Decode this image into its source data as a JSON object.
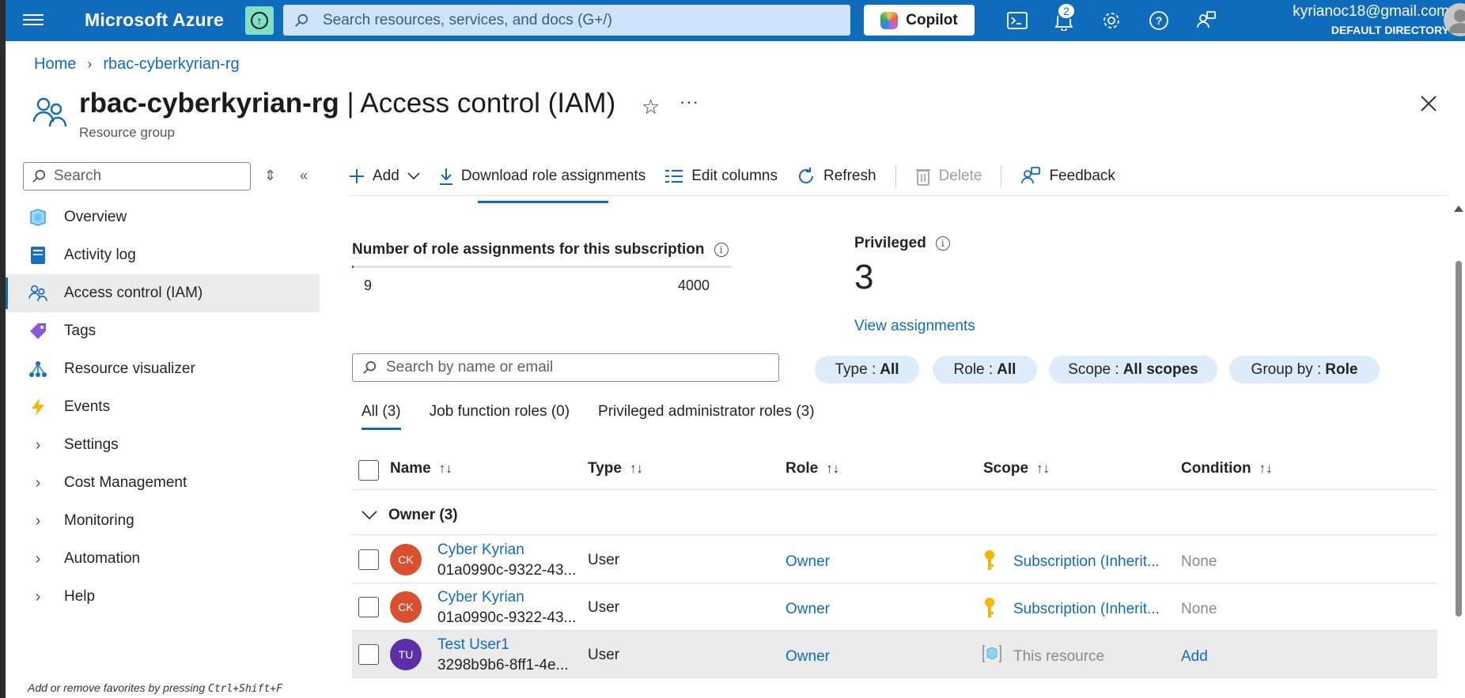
{
  "topbar": {
    "brand": "Microsoft Azure",
    "search_placeholder": "Search resources, services, and docs (G+/)",
    "copilot_label": "Copilot",
    "notification_count": "2",
    "account_email": "kyrianoc18@gmail.com",
    "account_directory": "DEFAULT DIRECTORY"
  },
  "breadcrumb": {
    "home": "Home",
    "resource": "rbac-cyberkyrian-rg"
  },
  "header": {
    "title_resource": "rbac-cyberkyrian-rg",
    "title_sep": " | ",
    "title_page": "Access control (IAM)",
    "subtitle": "Resource group"
  },
  "nav": {
    "search_placeholder": "Search",
    "items": [
      {
        "label": "Overview",
        "icon": "overview-icon"
      },
      {
        "label": "Activity log",
        "icon": "activity-log-icon"
      },
      {
        "label": "Access control (IAM)",
        "icon": "people-icon",
        "selected": true
      },
      {
        "label": "Tags",
        "icon": "tag-icon"
      },
      {
        "label": "Resource visualizer",
        "icon": "visualizer-icon"
      },
      {
        "label": "Events",
        "icon": "lightning-icon"
      },
      {
        "label": "Settings",
        "group": true
      },
      {
        "label": "Cost Management",
        "group": true
      },
      {
        "label": "Monitoring",
        "group": true
      },
      {
        "label": "Automation",
        "group": true
      },
      {
        "label": "Help",
        "group": true
      }
    ],
    "favorites_hint": "Add or remove favorites by pressing ",
    "favorites_keys": "Ctrl+Shift+F"
  },
  "toolbar": {
    "add": "Add",
    "download": "Download role assignments",
    "edit_columns": "Edit columns",
    "refresh": "Refresh",
    "delete": "Delete",
    "feedback": "Feedback"
  },
  "stats": {
    "assignments_label": "Number of role assignments for this subscription",
    "assignments_current": "9",
    "assignments_max": "4000",
    "assignments_fraction": 0.00225,
    "privileged_label": "Privileged",
    "privileged_count": "3",
    "view_assignments": "View assignments"
  },
  "filters": {
    "search_placeholder": "Search by name or email",
    "pills": [
      {
        "key": "Type : ",
        "value": "All"
      },
      {
        "key": "Role : ",
        "value": "All"
      },
      {
        "key": "Scope : ",
        "value": "All scopes"
      },
      {
        "key": "Group by : ",
        "value": "Role"
      }
    ]
  },
  "tabs": [
    {
      "label": "All (3)",
      "selected": true
    },
    {
      "label": "Job function roles (0)"
    },
    {
      "label": "Privileged administrator roles (3)"
    }
  ],
  "table": {
    "columns": [
      "Name",
      "Type",
      "Role",
      "Scope",
      "Condition"
    ],
    "group_label": "Owner (3)",
    "rows": [
      {
        "initials": "CK",
        "avatar_color": "#d9502e",
        "name": "Cyber Kyrian",
        "id": "01a0990c-9322-43...",
        "type": "User",
        "role": "Owner",
        "scope": "Subscription (Inherit...",
        "scope_icon": "key-icon",
        "condition": "None"
      },
      {
        "initials": "CK",
        "avatar_color": "#d9502e",
        "name": "Cyber Kyrian",
        "id": "01a0990c-9322-43...",
        "type": "User",
        "role": "Owner",
        "scope": "Subscription (Inherit...",
        "scope_icon": "key-icon",
        "condition": "None"
      },
      {
        "initials": "TU",
        "avatar_color": "#5b2fa6",
        "name": "Test User1",
        "id": "3298b9b6-8ff1-4e...",
        "type": "User",
        "role": "Owner",
        "scope": "This resource",
        "scope_icon": "resource-group-icon",
        "condition": "Add"
      }
    ]
  },
  "colors": {
    "accent": "#0f6cbd",
    "topbar": "#0f6cbd",
    "pill": "#dcecfb"
  }
}
